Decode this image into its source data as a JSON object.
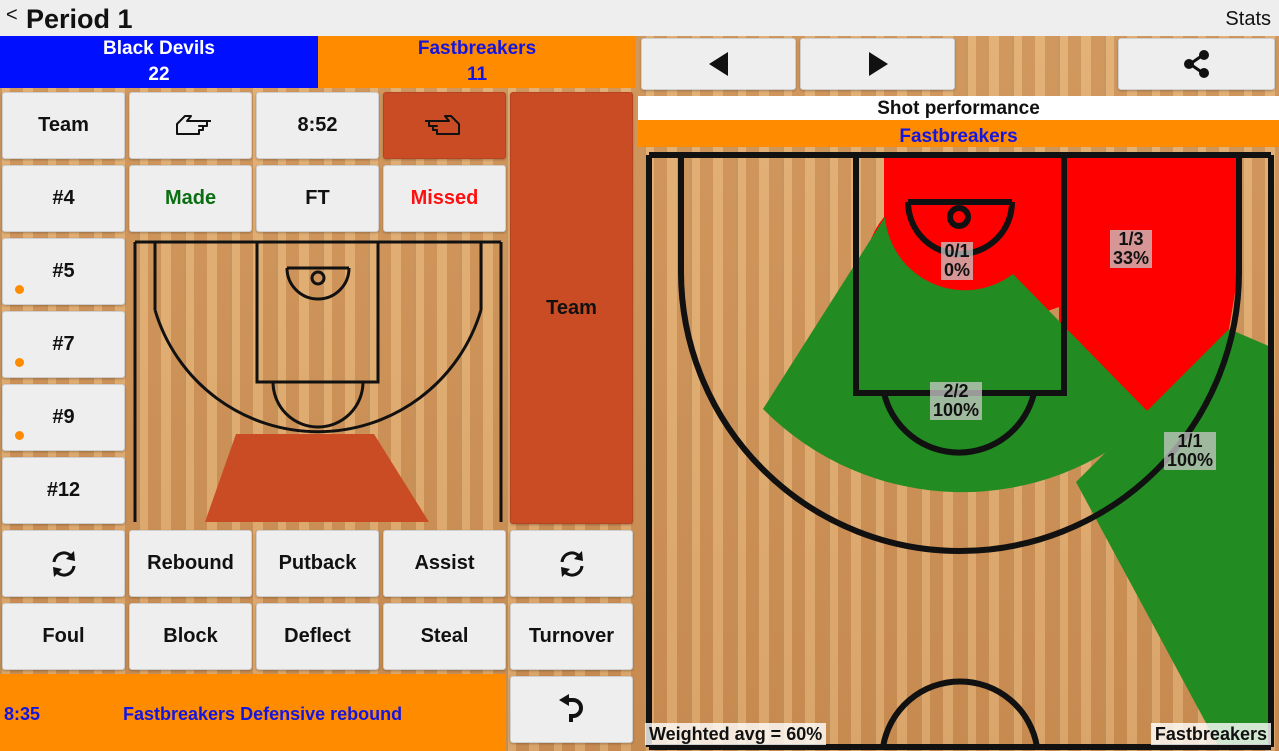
{
  "header": {
    "back_icon": "<",
    "title": "Period 1",
    "stats_label": "Stats"
  },
  "teams": [
    {
      "name": "Black Devils",
      "score": "22",
      "color": "#0010ff"
    },
    {
      "name": "Fastbreakers",
      "score": "11",
      "color": "#ff8c00"
    }
  ],
  "controls": {
    "team_label": "Team",
    "clock": "8:52",
    "player_numbers": [
      "#4",
      "#5",
      "#7",
      "#9",
      "#12"
    ],
    "made_label": "Made",
    "ft_label": "FT",
    "missed_label": "Missed",
    "team_side_label": "Team",
    "actions_row1": [
      "Rebound",
      "Putback",
      "Assist"
    ],
    "actions_row2": [
      "Foul",
      "Block",
      "Deflect",
      "Steal",
      "Turnover"
    ]
  },
  "status": {
    "time": "8:35",
    "text": "Fastbreakers Defensive rebound"
  },
  "performance": {
    "title": "Shot performance",
    "team": "Fastbreakers",
    "zones": [
      {
        "made_total": "0/1",
        "pct": "0%",
        "result": "cold"
      },
      {
        "made_total": "1/3",
        "pct": "33%",
        "result": "cold"
      },
      {
        "made_total": "2/2",
        "pct": "100%",
        "result": "hot"
      },
      {
        "made_total": "1/1",
        "pct": "100%",
        "result": "hot"
      }
    ],
    "weighted_avg": "Weighted avg = 60%",
    "footer_team": "Fastbreakers"
  },
  "colors": {
    "hot": "#228b22",
    "cold": "#ff0000",
    "accent": "#c94c24"
  },
  "icons": [
    "back-icon",
    "pointing-left-hand-icon",
    "pointing-right-hand-icon",
    "swap-icon",
    "prev-arrow-icon",
    "next-arrow-icon",
    "share-icon",
    "undo-icon"
  ]
}
